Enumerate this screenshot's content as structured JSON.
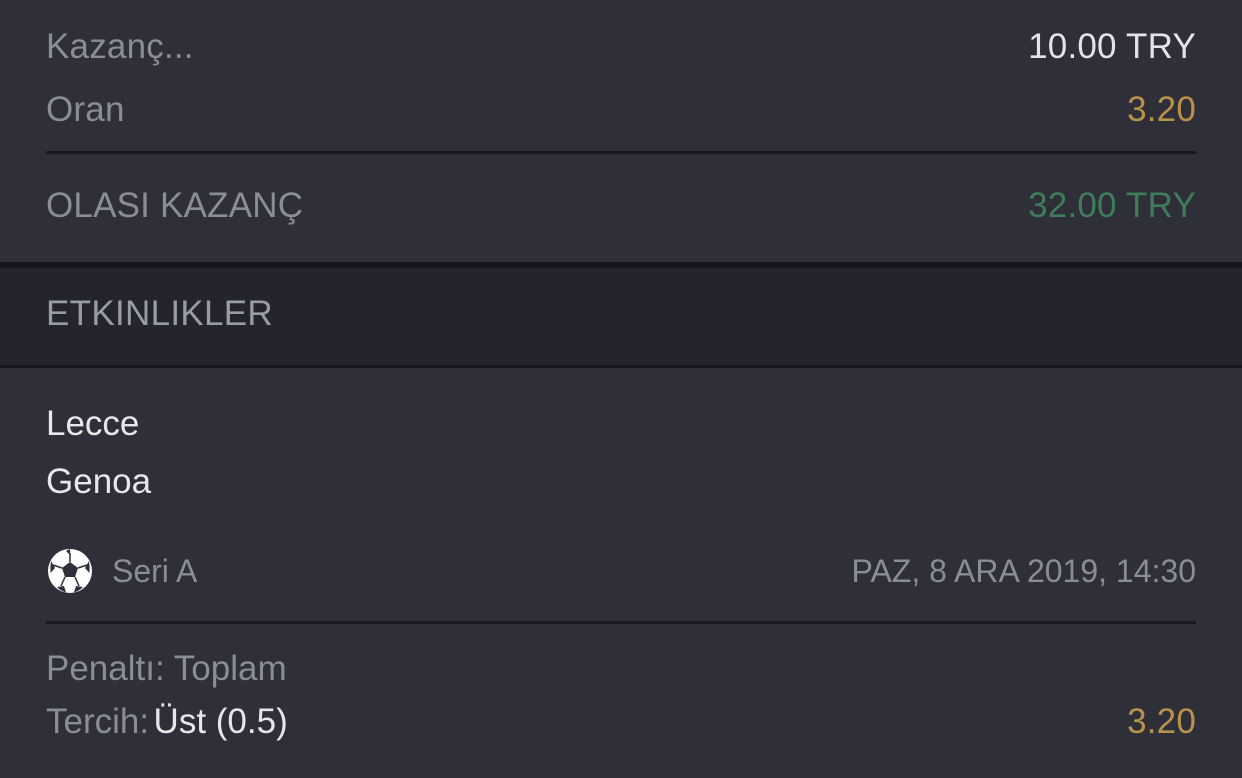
{
  "summary": {
    "stake_label": "Kazanç...",
    "stake_value": "10.00 TRY",
    "odds_label": "Oran",
    "odds_value": "3.20",
    "potential_label": "OLASI KAZANÇ",
    "potential_value": "32.00 TRY"
  },
  "section": {
    "title": "ETKINLIKLER"
  },
  "event": {
    "home_team": "Lecce",
    "away_team": "Genoa",
    "sport_icon": "soccer-ball-icon",
    "league": "Seri A",
    "datetime": "PAZ, 8 ARA 2019, 14:30",
    "market": "Penaltı: Toplam",
    "selection_label": "Tercih:",
    "selection_value": "Üst (0.5)",
    "selection_odds": "3.20"
  },
  "colors": {
    "background": "#2e2f39",
    "section_bar": "#23242d",
    "muted_text": "#8b8d96",
    "primary_text": "#e3e4e8",
    "odds_gold": "#b8924a",
    "win_green": "#3f7d5a"
  }
}
